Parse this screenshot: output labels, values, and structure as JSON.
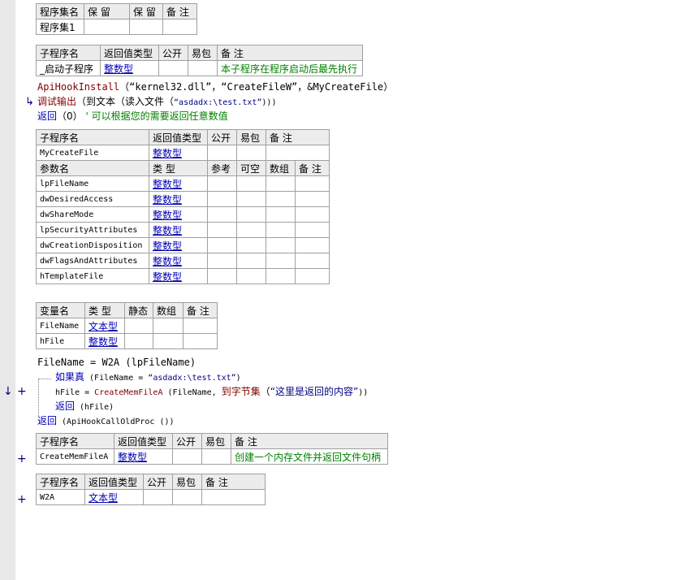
{
  "set_table": {
    "headers": [
      "程序集名",
      "保 留",
      "保 留",
      "备 注"
    ],
    "row": [
      "程序集1",
      "",
      "",
      ""
    ]
  },
  "startup_sub": {
    "headers": [
      "子程序名",
      "返回值类型",
      "公开",
      "易包",
      "备 注"
    ],
    "name": "_启动子程序",
    "ret": "整数型",
    "comment": "本子程序在程序启动后最先执行"
  },
  "startup_code": {
    "l1_fn": "ApiHookInstall",
    "l1_args": "（“kernel32.dll”，“CreateFileW”，&MyCreateFile）",
    "l2_fn": "调试输出",
    "l2_a": "（到文本（读入文件（",
    "l2_str": "“asdadx:\\test.txt”",
    "l2_b": ")))",
    "l3_kw": "返回",
    "l3_args": "（0）",
    "l3_cmt": "' 可以根据您的需要返回任意数值"
  },
  "mycreate_sub": {
    "headers": [
      "子程序名",
      "返回值类型",
      "公开",
      "易包",
      "备 注"
    ],
    "name": "MyCreateFile",
    "ret": "整数型",
    "param_headers": [
      "参数名",
      "类 型",
      "参考",
      "可空",
      "数组",
      "备 注"
    ],
    "params": [
      {
        "name": "lpFileName",
        "type": "整数型"
      },
      {
        "name": "dwDesiredAccess",
        "type": "整数型"
      },
      {
        "name": "dwShareMode",
        "type": "整数型"
      },
      {
        "name": "lpSecurityAttributes",
        "type": "整数型"
      },
      {
        "name": "dwCreationDisposition",
        "type": "整数型"
      },
      {
        "name": "dwFlagsAndAttributes",
        "type": "整数型"
      },
      {
        "name": "hTemplateFile",
        "type": "整数型"
      }
    ]
  },
  "locals": {
    "headers": [
      "变量名",
      "类 型",
      "静态",
      "数组",
      "备 注"
    ],
    "rows": [
      {
        "name": "FileName",
        "type": "文本型"
      },
      {
        "name": "hFile",
        "type": "整数型"
      }
    ]
  },
  "mycreate_code": {
    "l1": "FileName = W2A (lpFileName)",
    "l2_kw": "如果真",
    "l2_a": " (FileName = ",
    "l2_str": "“asdadx:\\test.txt”",
    "l2_b": ")",
    "l3_a": "hFile = ",
    "l3_fn": "CreateMemFileA",
    "l3_b": " (FileName, ",
    "l3_fn2": "到字节集",
    "l3_c": "（",
    "l3_str": "“这里是返回的内容”",
    "l3_d": "))",
    "l4_kw": "返回",
    "l4_a": " (hFile)",
    "l5_kw": "返回",
    "l5_a": " (ApiHookCallOldProc ())"
  },
  "creatememfile_sub": {
    "headers": [
      "子程序名",
      "返回值类型",
      "公开",
      "易包",
      "备 注"
    ],
    "name": "CreateMemFileA",
    "ret": "整数型",
    "comment": "创建一个内存文件并返回文件句柄"
  },
  "w2a_sub": {
    "headers": [
      "子程序名",
      "返回值类型",
      "公开",
      "易包",
      "备 注"
    ],
    "name": "W2A",
    "ret": "文本型"
  },
  "markers": {
    "arrow": "↳",
    "plus": "+",
    "arrow2": "↓"
  }
}
